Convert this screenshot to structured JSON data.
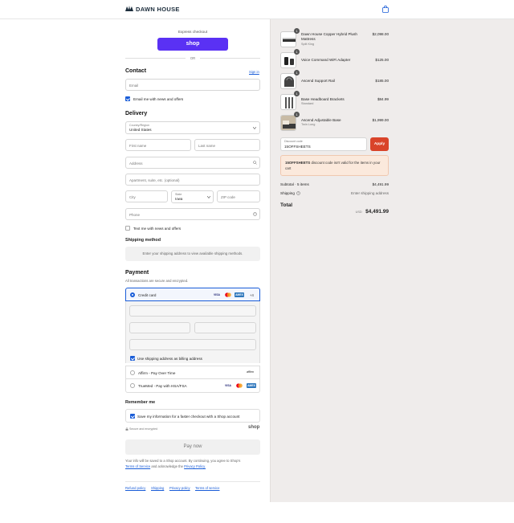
{
  "brand": {
    "name": "DAWN HOUSE"
  },
  "express": {
    "label": "Express checkout",
    "shop_button": "shop",
    "or": "OR"
  },
  "contact": {
    "heading": "Contact",
    "sign_in": "Sign in",
    "email_placeholder": "Email",
    "news_label": "Email me with news and offers"
  },
  "delivery": {
    "heading": "Delivery",
    "country_label": "Country/Region",
    "country_value": "United States",
    "first_name": "First name",
    "last_name": "Last name",
    "address": "Address",
    "apartment": "Apartment, suite, etc. (optional)",
    "city": "City",
    "state_label": "State",
    "state_value": "Iowa",
    "zip": "ZIP code",
    "phone": "Phone",
    "text_label": "Text me with news and offers"
  },
  "shipping_method": {
    "heading": "Shipping method",
    "message": "Enter your shipping address to view available shipping methods."
  },
  "payment": {
    "heading": "Payment",
    "subtitle": "All transactions are secure and encrypted.",
    "credit_card": "Credit card",
    "more_cards": "+4",
    "billing_label": "Use shipping address as billing address",
    "affirm": "Affirm - Pay Over Time",
    "affirm_logo": "affirm",
    "truemed": "TrueMed - Pay with HSA/FSA"
  },
  "cards": {
    "visa": "VISA",
    "amex": "AMEX"
  },
  "remember": {
    "heading": "Remember me",
    "save_label": "Save my information for a faster checkout with a Shop account",
    "secure": "Secure and encrypted",
    "shop": "shop"
  },
  "pay_now": "Pay now",
  "legal": {
    "line1": "Your info will be saved to a Shop account. By continuing, you agree to Shop's",
    "terms": "Terms of Service",
    "and": "and acknowledge the",
    "privacy": "Privacy Policy."
  },
  "footer_links": [
    "Refund policy",
    "Shipping",
    "Privacy policy",
    "Terms of service"
  ],
  "cart": {
    "items": [
      {
        "name": "Dawn House Copper Hybrid Plush Mattress",
        "variant": "Split King",
        "price": "$2,098.00",
        "qty": "1"
      },
      {
        "name": "Voice Command WiFi Adapter",
        "variant": "",
        "price": "$125.00",
        "qty": "1"
      },
      {
        "name": "Ascend Support Rail",
        "variant": "",
        "price": "$185.00",
        "qty": "1"
      },
      {
        "name": "Base Headboard Brackets",
        "variant": "Standard",
        "price": "$84.99",
        "qty": "1"
      },
      {
        "name": "Ascend Adjustable Base",
        "variant": "Twin Long",
        "price": "$1,999.00",
        "qty": "1"
      }
    ],
    "discount_label": "Discount code",
    "discount_value": "15OFFSHEETS",
    "apply": "Apply",
    "warning_code": "15OFFSHEETS",
    "warning_text": "discount code isn't valid for the items in your cart",
    "subtotal_label": "Subtotal · 5 items",
    "subtotal_value": "$4,491.99",
    "shipping_label": "Shipping",
    "shipping_value": "Enter shipping address",
    "total_label": "Total",
    "currency": "USD",
    "total_value": "$4,491.99"
  },
  "colors": {
    "shop_purple": "#5a31f4",
    "apply_red": "#d9442a",
    "accent_blue": "#1a5dd8",
    "warning_bg": "#fbe9dc"
  }
}
